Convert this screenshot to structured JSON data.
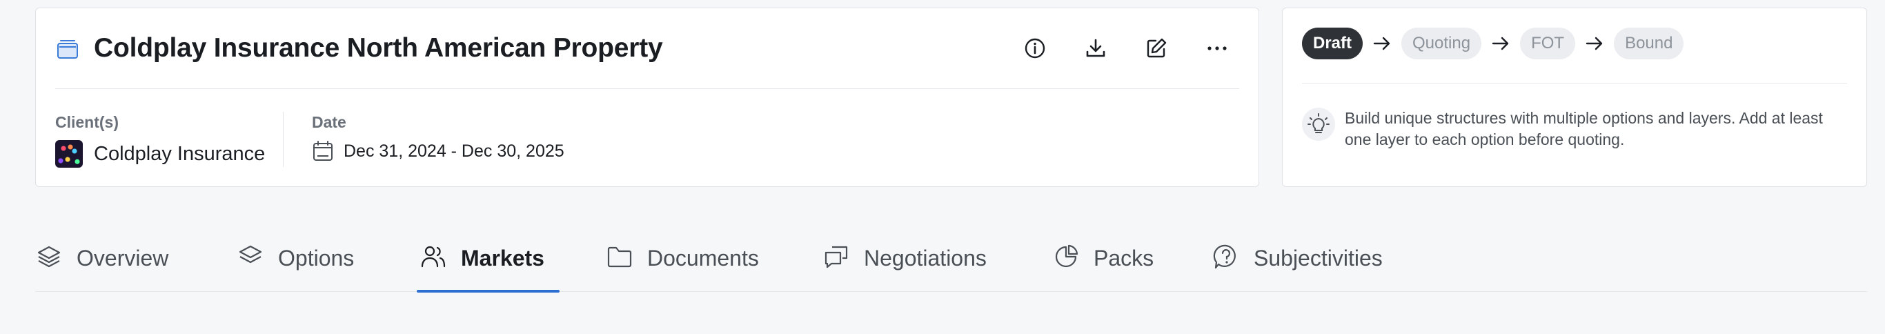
{
  "header": {
    "title": "Coldplay Insurance North American Property",
    "client_label": "Client(s)",
    "client_name": "Coldplay Insurance",
    "date_label": "Date",
    "date_range": "Dec 31, 2024 - Dec 30, 2025",
    "actions": [
      "info-icon",
      "download-icon",
      "edit-icon",
      "more-icon"
    ]
  },
  "status": {
    "steps": [
      {
        "label": "Draft",
        "active": true
      },
      {
        "label": "Quoting",
        "active": false
      },
      {
        "label": "FOT",
        "active": false
      },
      {
        "label": "Bound",
        "active": false
      }
    ],
    "hint": "Build unique structures with multiple options and layers. Add at least one layer to each option before quoting."
  },
  "tabs": [
    {
      "label": "Overview",
      "icon": "layers-icon",
      "active": false
    },
    {
      "label": "Options",
      "icon": "stack-icon",
      "active": false
    },
    {
      "label": "Markets",
      "icon": "users-icon",
      "active": true
    },
    {
      "label": "Documents",
      "icon": "folder-icon",
      "active": false
    },
    {
      "label": "Negotiations",
      "icon": "chat-icon",
      "active": false
    },
    {
      "label": "Packs",
      "icon": "pie-chart-icon",
      "active": false
    },
    {
      "label": "Subjectivities",
      "icon": "question-bubble-icon",
      "active": false
    }
  ],
  "colors": {
    "accent": "#2d6fd0",
    "active_step": "#2f3338",
    "inactive_step": "#ebedf0",
    "background": "#f6f7f9"
  }
}
